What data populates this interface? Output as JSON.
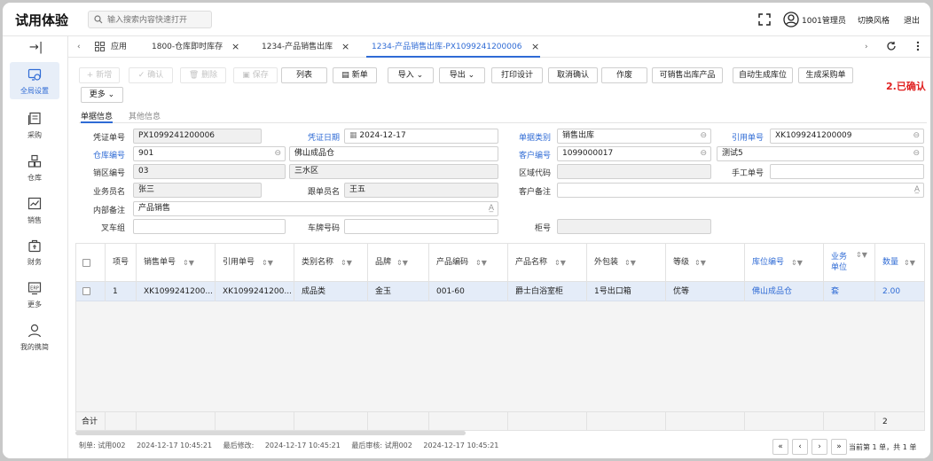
{
  "app": {
    "title": "试用体验"
  },
  "search": {
    "placeholder": "输入搜索内容快速打开"
  },
  "header": {
    "user": "1001管理员",
    "switch_style": "切换风格",
    "logout": "退出"
  },
  "sidebar": {
    "collapse": "→|",
    "items": [
      {
        "label": "全局设置",
        "icon": "global-settings-icon",
        "active": true
      },
      {
        "label": "采购",
        "icon": "purchase-icon"
      },
      {
        "label": "仓库",
        "icon": "warehouse-icon"
      },
      {
        "label": "销售",
        "icon": "sales-chart-icon"
      },
      {
        "label": "财务",
        "icon": "finance-icon"
      },
      {
        "label": "更多",
        "icon": "erp-more-icon"
      },
      {
        "label": "我的携简",
        "icon": "user-icon"
      }
    ]
  },
  "tabs": [
    {
      "label": "应用"
    },
    {
      "label": "1800-仓库即时库存"
    },
    {
      "label": "1234-产品销售出库"
    },
    {
      "label": "1234-产品销售出库-PX1099241200006",
      "active": true
    }
  ],
  "toolbar": {
    "add": "+ 新增",
    "confirm": "✓ 确认",
    "delete": "删除",
    "save": "保存",
    "columns": "列表",
    "new": "新单",
    "import": "导入",
    "export": "导出",
    "print_design": "打印设计",
    "cancel_confirm": "取消确认",
    "void": "作废",
    "sellable_products": "可销售出库产品",
    "auto_location": "自动生成库位",
    "gen_purchase": "生成采购单",
    "more": "更多"
  },
  "status_text": "2.已确认",
  "form_tabs": [
    "单据信息",
    "其他信息"
  ],
  "form": {
    "voucher_no": {
      "label": "凭证单号",
      "value": "PX1099241200006"
    },
    "voucher_date": {
      "label": "凭证日期",
      "value": "2024-12-17"
    },
    "doc_type": {
      "label": "单据类别",
      "value": "销售出库"
    },
    "ref_no": {
      "label": "引用单号",
      "value": "XK1099241200009"
    },
    "warehouse_code": {
      "label": "仓库编号",
      "value": "901"
    },
    "warehouse_name": {
      "value": "佛山成品仓"
    },
    "customer_code": {
      "label": "客户编号",
      "value": "1099000017"
    },
    "customer_name": {
      "value": "测试5"
    },
    "sales_area_code": {
      "label": "销区编号",
      "value": "03"
    },
    "sales_area_name": {
      "value": "三水区"
    },
    "region_code": {
      "label": "区域代码",
      "value": ""
    },
    "manual_no": {
      "label": "手工单号",
      "value": ""
    },
    "salesperson": {
      "label": "业务员名",
      "value": "张三"
    },
    "follower": {
      "label": "跟单员名",
      "value": "王五"
    },
    "customer_note": {
      "label": "客户备注",
      "value": ""
    },
    "internal_note": {
      "label": "内部备注",
      "value": "产品销售"
    },
    "forklift_group": {
      "label": "叉车组",
      "value": ""
    },
    "plate_no": {
      "label": "车牌号码",
      "value": ""
    },
    "cabinet_no": {
      "label": "柜号",
      "value": ""
    }
  },
  "grid": {
    "headers": [
      "项号",
      "销售单号",
      "引用单号",
      "类别名称",
      "品牌",
      "产品编码",
      "产品名称",
      "外包装",
      "等级",
      "库位编号",
      "业务单位",
      "数量"
    ],
    "row": [
      "1",
      "XK1099241200...",
      "XK1099241200...",
      "成品类",
      "金玉",
      "001-60",
      "爵士白浴室柜",
      "1号出口箱",
      "优等",
      "佛山成品仓",
      "套",
      "2.00"
    ],
    "total_label": "合计",
    "total_qty": "2"
  },
  "footer": {
    "creator": "制单: 试用002",
    "created": "2024-12-17 10:45:21",
    "modified_label": "最后修改:",
    "modified": "2024-12-17 10:45:21",
    "approver": "最后审核: 试用002",
    "approved": "2024-12-17 10:45:21"
  },
  "pager": {
    "first": "«",
    "prev": "‹",
    "next": "›",
    "last": "»",
    "info": "当前第 1 单，共 1 单"
  }
}
